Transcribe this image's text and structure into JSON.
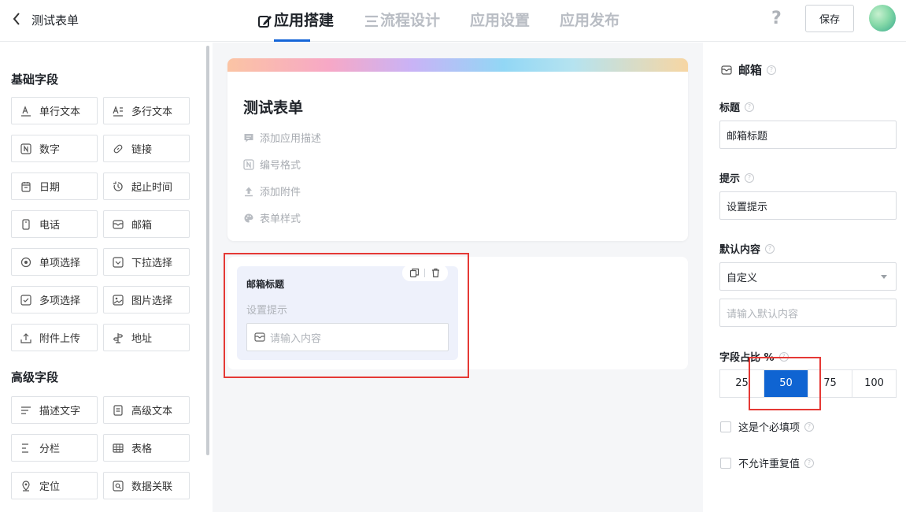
{
  "header": {
    "back_icon": "chevron-left-icon",
    "app_title": "测试表单",
    "tabs": [
      {
        "label": "应用搭建",
        "icon": "edit-icon",
        "active": true
      },
      {
        "label": "流程设计",
        "icon": "flow-icon",
        "active": false
      },
      {
        "label": "应用设置",
        "active": false
      },
      {
        "label": "应用发布",
        "active": false
      }
    ],
    "help_label": "?",
    "save_label": "保存"
  },
  "left": {
    "basic_title": "基础字段",
    "basic_fields": [
      {
        "label": "单行文本",
        "icon": "text-line-icon"
      },
      {
        "label": "多行文本",
        "icon": "text-multi-icon"
      },
      {
        "label": "数字",
        "icon": "number-icon"
      },
      {
        "label": "链接",
        "icon": "link-icon"
      },
      {
        "label": "日期",
        "icon": "calendar-icon"
      },
      {
        "label": "起止时间",
        "icon": "clock-range-icon"
      },
      {
        "label": "电话",
        "icon": "phone-icon"
      },
      {
        "label": "邮箱",
        "icon": "mail-icon"
      },
      {
        "label": "单项选择",
        "icon": "radio-icon"
      },
      {
        "label": "下拉选择",
        "icon": "dropdown-icon"
      },
      {
        "label": "多项选择",
        "icon": "checkbox-icon"
      },
      {
        "label": "图片选择",
        "icon": "image-icon"
      },
      {
        "label": "附件上传",
        "icon": "upload-icon"
      },
      {
        "label": "地址",
        "icon": "signpost-icon"
      }
    ],
    "advanced_title": "高级字段",
    "advanced_fields": [
      {
        "label": "描述文字",
        "icon": "description-icon"
      },
      {
        "label": "高级文本",
        "icon": "rich-text-icon"
      },
      {
        "label": "分栏",
        "icon": "columns-icon"
      },
      {
        "label": "表格",
        "icon": "table-icon"
      },
      {
        "label": "定位",
        "icon": "location-icon"
      },
      {
        "label": "数据关联",
        "icon": "data-link-icon"
      }
    ]
  },
  "canvas": {
    "form_title": "测试表单",
    "meta": [
      {
        "label": "添加应用描述",
        "icon": "comment-icon"
      },
      {
        "label": "编号格式",
        "icon": "number-icon"
      },
      {
        "label": "添加附件",
        "icon": "upload-icon"
      },
      {
        "label": "表单样式",
        "icon": "palette-icon"
      }
    ],
    "field_card": {
      "title": "邮箱标题",
      "hint": "设置提示",
      "placeholder": "请输入内容",
      "copy_icon": "copy-icon",
      "delete_icon": "trash-icon"
    }
  },
  "props": {
    "type_label": "邮箱",
    "title_label": "标题",
    "title_value": "邮箱标题",
    "hint_label": "提示",
    "hint_value": "设置提示",
    "default_label": "默认内容",
    "default_mode": "自定义",
    "default_placeholder": "请输入默认内容",
    "width_label": "字段占比 %",
    "width_options": [
      "25",
      "50",
      "75",
      "100"
    ],
    "width_selected": "50",
    "required_label": "这是个必填项",
    "unique_label": "不允许重复值"
  },
  "colors": {
    "accent": "#1565d8",
    "selected_segment": "#0f64d2",
    "highlight_box": "#e53935"
  }
}
